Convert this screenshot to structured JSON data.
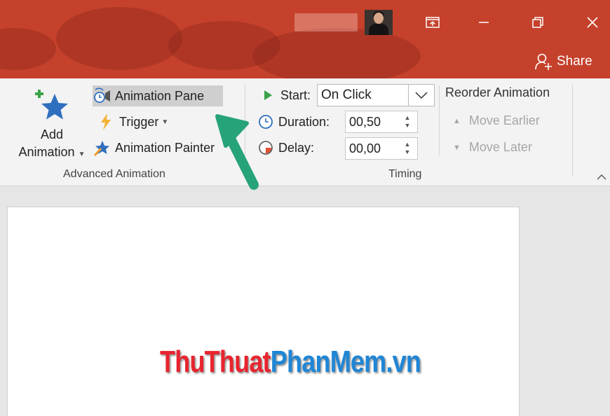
{
  "title_bar": {
    "controls": [
      {
        "name": "ribbon-display-options",
        "icon": "ribbon-display-icon"
      },
      {
        "name": "minimize",
        "icon": "minimize-icon"
      },
      {
        "name": "restore",
        "icon": "restore-icon"
      },
      {
        "name": "close",
        "icon": "close-icon"
      }
    ],
    "share_label": "Share"
  },
  "ribbon": {
    "advanced_animation": {
      "add_animation_line1": "Add",
      "add_animation_line2": "Animation",
      "animation_pane": "Animation Pane",
      "trigger": "Trigger",
      "animation_painter": "Animation Painter",
      "group_label": "Advanced Animation"
    },
    "timing": {
      "start_label": "Start:",
      "start_value": "On Click",
      "duration_label": "Duration:",
      "duration_value": "00,50",
      "delay_label": "Delay:",
      "delay_value": "00,00",
      "group_label": "Timing"
    },
    "reorder": {
      "title": "Reorder Animation",
      "move_earlier": "Move Earlier",
      "move_later": "Move Later"
    }
  },
  "slide": {
    "watermark_part1": "ThuThuat",
    "watermark_part2": "PhanMem.vn"
  },
  "colors": {
    "title_bar": "#c5412b",
    "ribbon_bg": "#f3f3f3",
    "highlight": "#cfcfcf",
    "callout_arrow": "#27a37a"
  }
}
